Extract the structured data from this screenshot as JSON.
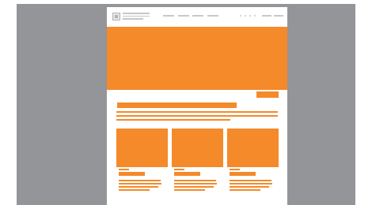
{
  "colors": {
    "backdrop": "#939598",
    "page": "#ffffff",
    "accent": "#f48a2a",
    "placeholder_grey": "#c8c8c8"
  },
  "header": {
    "logo_icon": "logo-mark-icon"
  }
}
